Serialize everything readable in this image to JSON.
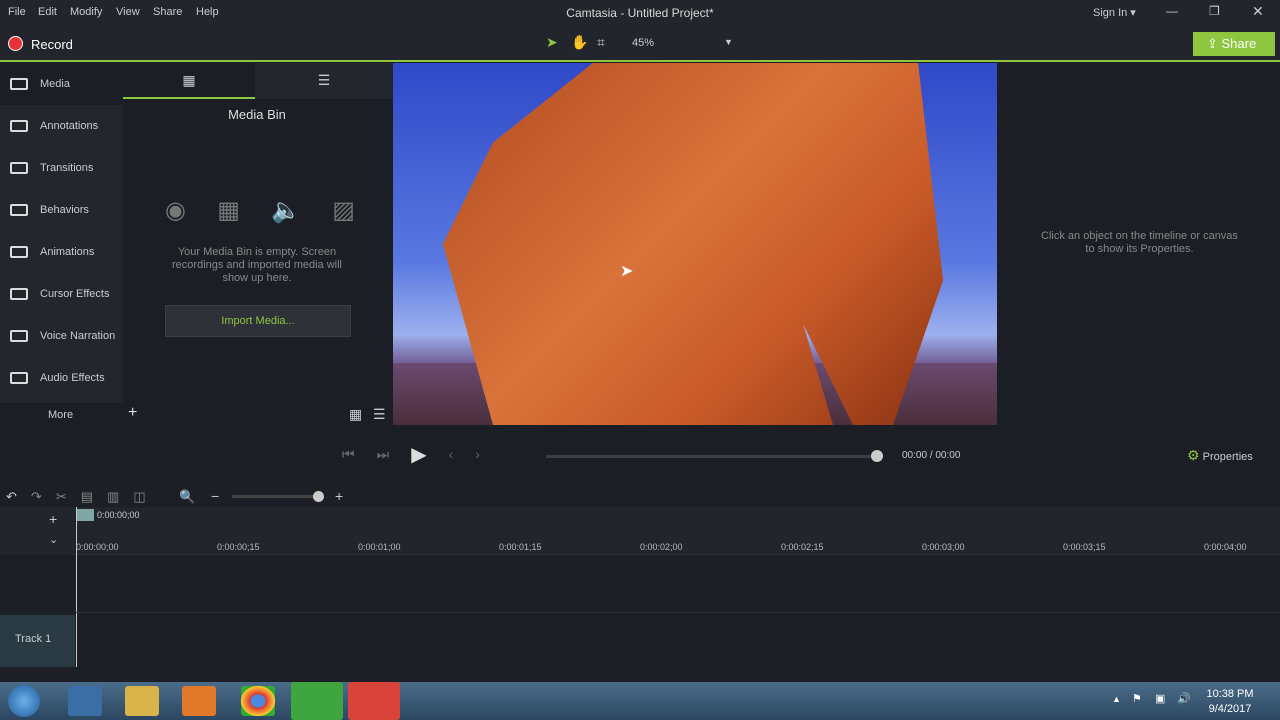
{
  "menu": [
    "File",
    "Edit",
    "Modify",
    "View",
    "Share",
    "Help"
  ],
  "title": "Camtasia - Untitled Project*",
  "sign_in": "Sign In",
  "record": "Record",
  "zoom": "45%",
  "share": "Share",
  "sidebar": [
    {
      "label": "Media"
    },
    {
      "label": "Annotations"
    },
    {
      "label": "Transitions"
    },
    {
      "label": "Behaviors"
    },
    {
      "label": "Animations"
    },
    {
      "label": "Cursor Effects"
    },
    {
      "label": "Voice Narration"
    },
    {
      "label": "Audio Effects"
    }
  ],
  "more": "More",
  "media": {
    "title": "Media Bin",
    "empty": "Your Media Bin is empty. Screen recordings and imported media will show up here.",
    "import": "Import Media..."
  },
  "props": {
    "hint": "Click an object on the timeline or canvas to show its Properties.",
    "button": "Properties"
  },
  "playback": {
    "time": "00:00",
    "sep": "/",
    "total": "00:00"
  },
  "timeline": {
    "playhead": "0:00:00;00",
    "ticks": [
      "0:00:00;00",
      "0:00:00;15",
      "0:00:01;00",
      "0:00:01;15",
      "0:00:02;00",
      "0:00:02;15",
      "0:00:03;00",
      "0:00:03;15",
      "0:00:04;00"
    ],
    "track": "Track 1"
  },
  "clock": {
    "time": "10:38 PM",
    "date": "9/4/2017"
  },
  "accent": "#8ec63f"
}
